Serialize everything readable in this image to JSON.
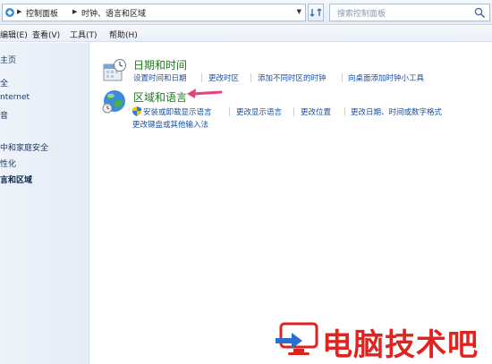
{
  "address_bar": {
    "breadcrumbs": [
      "控制面板",
      "时钟、语言和区域"
    ],
    "search_placeholder": "搜索控制面板"
  },
  "menu": {
    "items": [
      "编辑(E)",
      "查看(V)",
      "工具(T)",
      "帮助(H)"
    ]
  },
  "sidebar": {
    "items": [
      "主页",
      "全",
      "nternet",
      "音",
      "中和家庭安全",
      "性化",
      "言和区域",
      ""
    ],
    "active_index": 6
  },
  "categories": [
    {
      "title": "日期和时间",
      "links": [
        "设置时间和日期",
        "更改时区",
        "添加不同时区的时钟",
        "向桌面添加时钟小工具"
      ]
    },
    {
      "title": "区域和语言",
      "links_row1": [
        "安装或卸载显示语言",
        "更改显示语言",
        "更改位置",
        "更改日期、时间或数字格式"
      ],
      "links_row2": [
        "更改键盘或其他输入法"
      ]
    }
  ],
  "watermark": {
    "text": "电脑技术吧"
  },
  "colors": {
    "category_title": "#1f7a1f",
    "link": "#1a4fa0",
    "annotation_arrow": "#e8407a",
    "watermark": "#e0231f"
  }
}
